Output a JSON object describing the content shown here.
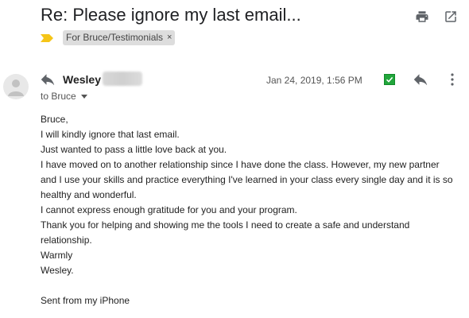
{
  "email": {
    "subject": "Re: Please ignore my last email...",
    "label_chip": "For Bruce/Testimonials",
    "label_chip_close": "×",
    "sender_name": "Wesley",
    "recipient_line": "to Bruce",
    "date": "Jan 24, 2019, 1:56 PM",
    "body_lines": [
      "Bruce,",
      "I will kindly ignore that last email.",
      "Just wanted to pass a little love back at you.",
      "I have moved on to another relationship since I have done the class. However, my new partner and I use your skills and practice everything I've learned in your class every single day and it is so healthy and wonderful.",
      "I cannot express enough gratitude for you and your program.",
      "Thank you for helping and showing me the tools I need to create a safe and understand relationship.",
      "Warmly",
      "Wesley."
    ],
    "signature": "Sent from my iPhone"
  },
  "icons": {
    "print": "print-icon",
    "open_new_window": "open-in-new-window-icon",
    "importance": "importance-marker-icon",
    "avatar": "default-avatar-icon",
    "reply": "reply-icon",
    "check": "green-checkbox-icon",
    "more": "more-vertical-icon",
    "caret": "chevron-down-icon"
  },
  "colors": {
    "importance_marker": "#f5c518",
    "label_chip_bg": "#dddddd",
    "checkbox_green": "#21a63b",
    "icon_gray": "#5f6368"
  }
}
